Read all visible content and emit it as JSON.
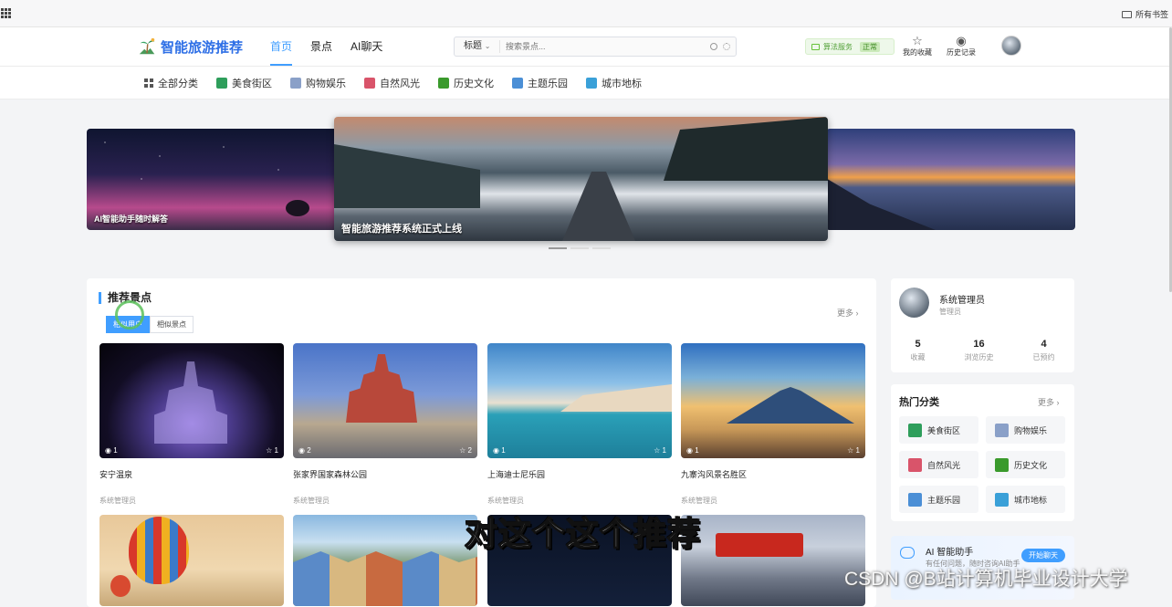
{
  "browser": {
    "bookmarks_label": "所有书签"
  },
  "header": {
    "logo": "智能旅游推荐",
    "nav": [
      "首页",
      "景点",
      "AI聊天"
    ],
    "search": {
      "select": "标题",
      "placeholder": "搜索景点..."
    },
    "status": {
      "label": "算法服务",
      "tag": "正常"
    },
    "favorites": "我的收藏",
    "history": "历史记录"
  },
  "categories": [
    {
      "label": "全部分类",
      "icon": "grid-icon",
      "color": "#555555"
    },
    {
      "label": "美食街区",
      "icon": "shop-icon",
      "color": "#2e9e5b"
    },
    {
      "label": "购物娱乐",
      "icon": "shopping-icon",
      "color": "#8aa0c8"
    },
    {
      "label": "自然风光",
      "icon": "nature-icon",
      "color": "#d9546a"
    },
    {
      "label": "历史文化",
      "icon": "tree-icon",
      "color": "#3a9a2c"
    },
    {
      "label": "主题乐园",
      "icon": "mountain-icon",
      "color": "#4b8fd6"
    },
    {
      "label": "城市地标",
      "icon": "globe-icon",
      "color": "#3aa0d8"
    }
  ],
  "carousel": {
    "slides": [
      {
        "caption": "AI智能助手随时解答"
      },
      {
        "caption": "智能旅游推荐系统正式上线"
      },
      {
        "caption": ""
      }
    ]
  },
  "recommend": {
    "title": "推荐景点",
    "more": "更多",
    "tabs": [
      "相似用户",
      "相似景点"
    ],
    "cards": [
      {
        "title": "安宁温泉",
        "author": "系统管理员",
        "views": "1",
        "favs": "1"
      },
      {
        "title": "张家界国家森林公园",
        "author": "系统管理员",
        "views": "2",
        "favs": "2"
      },
      {
        "title": "上海迪士尼乐园",
        "author": "系统管理员",
        "views": "1",
        "favs": "1"
      },
      {
        "title": "九寨沟风景名胜区",
        "author": "系统管理员",
        "views": "1",
        "favs": "1"
      }
    ]
  },
  "profile": {
    "name": "系统管理员",
    "role": "管理员",
    "stats": [
      {
        "value": "5",
        "label": "收藏"
      },
      {
        "value": "16",
        "label": "浏览历史"
      },
      {
        "value": "4",
        "label": "已预约"
      }
    ]
  },
  "hot": {
    "title": "热门分类",
    "more": "更多",
    "items": [
      {
        "label": "美食街区",
        "color": "#2e9e5b"
      },
      {
        "label": "购物娱乐",
        "color": "#8aa0c8"
      },
      {
        "label": "自然风光",
        "color": "#d9546a"
      },
      {
        "label": "历史文化",
        "color": "#3a9a2c"
      },
      {
        "label": "主题乐园",
        "color": "#4b8fd6"
      },
      {
        "label": "城市地标",
        "color": "#3aa0d8"
      }
    ]
  },
  "ai": {
    "title": "AI 智能助手",
    "sub": "有任何问题，随时咨询AI助手",
    "button": "开始聊天"
  },
  "overlay": {
    "subtitle": "对这个这个推荐",
    "watermark": "CSDN @B站计算机毕业设计大学"
  },
  "colors": {
    "accent": "#409eff",
    "logo": "#2e6fe6",
    "ok": "#67c23a"
  }
}
